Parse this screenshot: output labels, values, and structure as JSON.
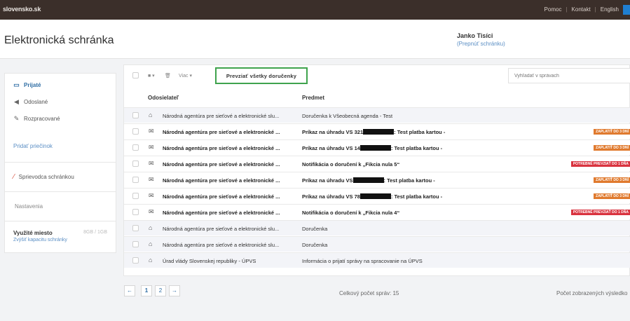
{
  "topbar": {
    "brand": "slovensko.sk",
    "links": [
      "Pomoc",
      "Kontakt",
      "English"
    ],
    "separator": "|"
  },
  "header": {
    "title": "Elektronická schránka",
    "user_name": "Janko Tisíci",
    "switch_box": "(Prepnúť schránku)"
  },
  "sidebar": {
    "items": [
      {
        "label": "Prijaté",
        "icon": "inbox-icon",
        "active": true
      },
      {
        "label": "Odoslané",
        "icon": "send-icon",
        "active": false
      },
      {
        "label": "Rozpracované",
        "icon": "pencil-icon",
        "active": false
      }
    ],
    "add_folder": "Pridať priečinok",
    "guide": "Sprievodca schránkou",
    "settings": "Nastavenia",
    "space_label": "Využité miesto",
    "space_value": "8GB / 1GB",
    "space_more": "Zvýšiť kapacitu schránky"
  },
  "toolbar": {
    "more": "Viac",
    "accept_all": "Prevziať všetky doručenky",
    "search_placeholder": "Vyhľadať v správach"
  },
  "table": {
    "col_sender": "Odosielateľ",
    "col_subject": "Predmet",
    "rows": [
      {
        "sender": "Národná agentúra pre sieťové a elektronické slu...",
        "subject": "Doručenka k Všeobecná agenda - Test",
        "subject_tail": "",
        "unread": false,
        "badge": "",
        "badge_color": ""
      },
      {
        "sender": "Národná agentúra pre sieťové a elektronické ...",
        "subject": "Príkaz na úhradu VS 321",
        "subject_tail": ": Test platba kartou -",
        "unread": true,
        "badge": "ZAPLATIŤ DO 3 DNÍ",
        "badge_color": "orange"
      },
      {
        "sender": "Národná agentúra pre sieťové a elektronické ...",
        "subject": "Príkaz na úhradu VS 14",
        "subject_tail": ": Test platba kartou -",
        "unread": true,
        "badge": "ZAPLATIŤ DO 3 DNÍ",
        "badge_color": "orange"
      },
      {
        "sender": "Národná agentúra pre sieťové a elektronické ...",
        "subject": "Notifikácia o doručení k „Fikcia nula 5“",
        "subject_tail": "",
        "unread": true,
        "badge": "POTREBNÉ PREVZIAŤ DO 1 DŇA",
        "badge_color": "red"
      },
      {
        "sender": "Národná agentúra pre sieťové a elektronické ...",
        "subject": "Príkaz na úhradu VS",
        "subject_tail": ": Test platba kartou -",
        "unread": true,
        "badge": "ZAPLATIŤ DO 3 DNÍ",
        "badge_color": "orange"
      },
      {
        "sender": "Národná agentúra pre sieťové a elektronické ...",
        "subject": "Príkaz na úhradu VS 78",
        "subject_tail": ": Test platba kartou -",
        "unread": true,
        "badge": "ZAPLATIŤ DO 3 DNÍ",
        "badge_color": "orange"
      },
      {
        "sender": "Národná agentúra pre sieťové a elektronické ...",
        "subject": "Notifikácia o doručení k „Fikcia nula 4“",
        "subject_tail": "",
        "unread": true,
        "badge": "POTREBNÉ PREVZIAŤ DO 1 DŇA",
        "badge_color": "red"
      },
      {
        "sender": "Národná agentúra pre sieťové a elektronické slu...",
        "subject": "Doručenka",
        "subject_tail": "",
        "unread": false,
        "badge": "",
        "badge_color": ""
      },
      {
        "sender": "Národná agentúra pre sieťové a elektronické slu...",
        "subject": "Doručenka",
        "subject_tail": "",
        "unread": false,
        "badge": "",
        "badge_color": ""
      },
      {
        "sender": "Úrad vlády Slovenskej republiky - ÚPVS",
        "subject": "Informácia o prijatí správy na spracovanie na ÚPVS",
        "subject_tail": "",
        "unread": false,
        "badge": "",
        "badge_color": ""
      }
    ]
  },
  "pager": {
    "prev": "←",
    "pages": [
      "1",
      "2"
    ],
    "next": "→",
    "total": "Celkový počet správ: 15",
    "shown": "Počet zobrazených výsledko"
  },
  "colors": {
    "topbar": "#3b2f2a",
    "accent": "#2e6da4",
    "highlight_border": "#3fa34d",
    "badge_orange": "#e07a2e",
    "badge_red": "#d9333f"
  }
}
